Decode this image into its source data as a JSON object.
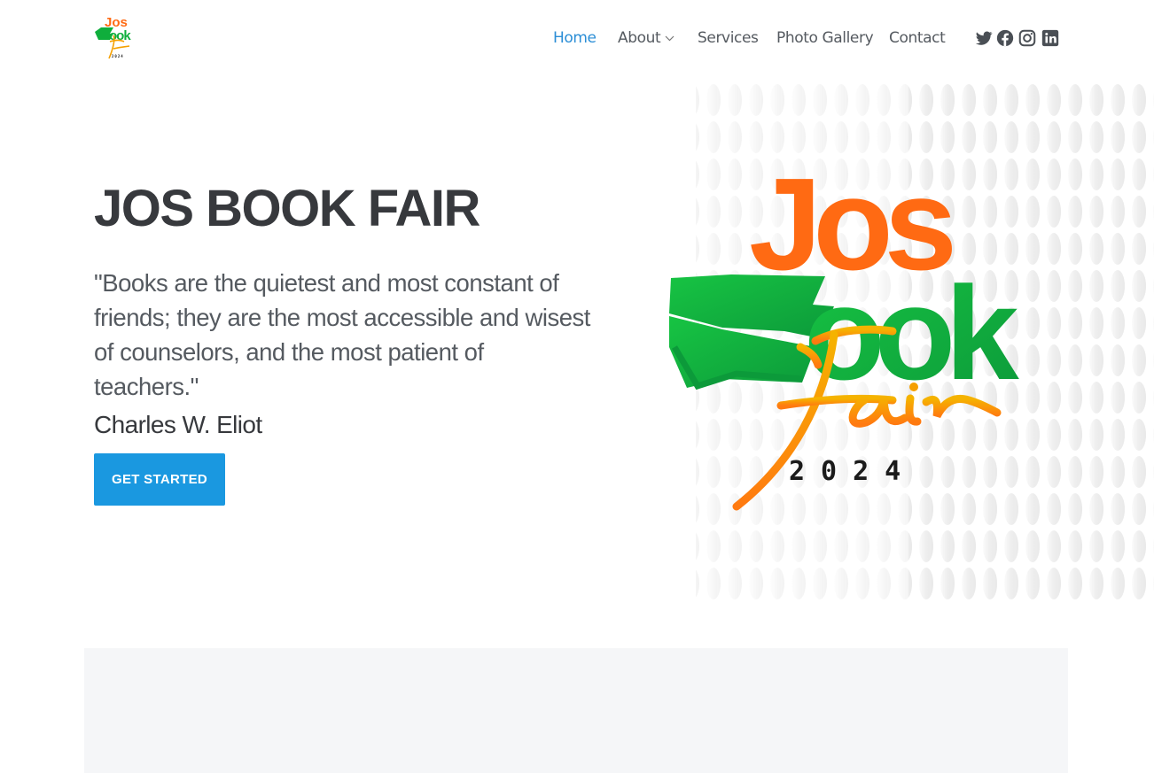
{
  "brand": {
    "logo_alt": "Jos Book Fair 2024",
    "logo_text": {
      "line1": "Jos",
      "line2": "Book",
      "line3": "Fair",
      "year": "2024"
    }
  },
  "nav": {
    "items": [
      {
        "label": "Home",
        "active": true
      },
      {
        "label": "About",
        "active": false,
        "has_dropdown": true
      },
      {
        "label": "Services",
        "active": false
      },
      {
        "label": "Photo Gallery",
        "active": false
      },
      {
        "label": "Contact",
        "active": false
      }
    ],
    "social": [
      "twitter-icon",
      "facebook-icon",
      "instagram-icon",
      "linkedin-icon"
    ]
  },
  "hero": {
    "title": "JOS BOOK FAIR",
    "quote": "\"Books are the quietest and most constant of friends; they are the most accessible and wisest of counselors, and the most patient of teachers.\"",
    "author": "Charles W. Eliot",
    "cta_label": "GET STARTED"
  },
  "colors": {
    "accent": "#1a98e0",
    "nav_active": "#2b8ed6",
    "logo_orange": "#ff6a13",
    "logo_green": "#0fae3c",
    "logo_gold": "#f5a000"
  }
}
